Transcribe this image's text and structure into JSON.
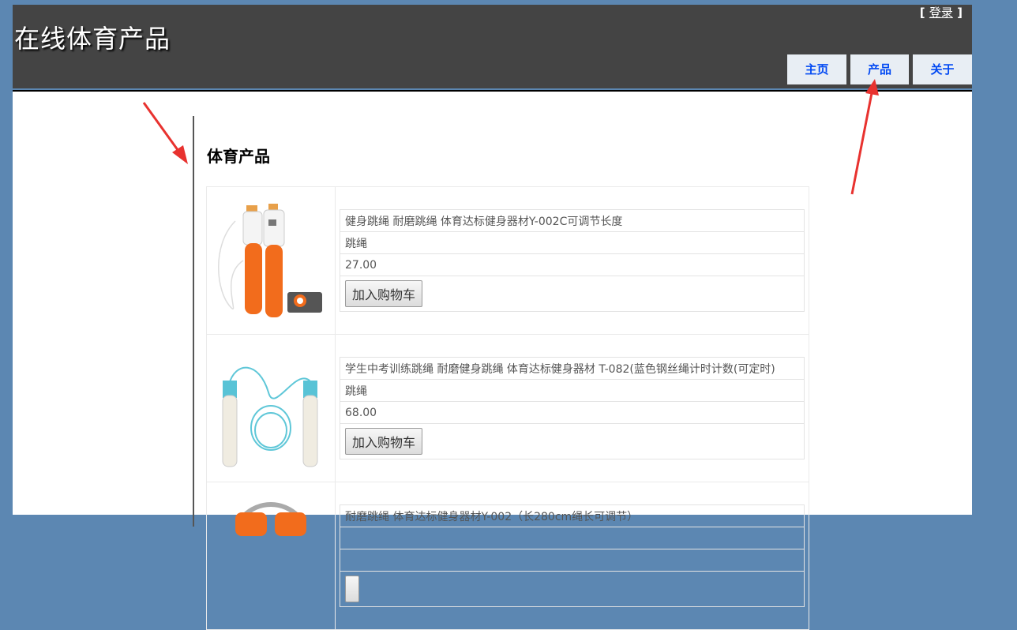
{
  "header": {
    "site_title": "在线体育产品",
    "login_bracket_open": "[",
    "login_label": "登录",
    "login_bracket_close": "]"
  },
  "menu": [
    {
      "label": "主页"
    },
    {
      "label": "产品"
    },
    {
      "label": "关于"
    }
  ],
  "main": {
    "section_title": "体育产品",
    "products": [
      {
        "name": "健身跳绳 耐磨跳绳 体育达标健身器材Y-002C可调节长度",
        "category": "跳绳",
        "price": "27.00",
        "button": "加入购物车"
      },
      {
        "name": "学生中考训练跳绳 耐磨健身跳绳 体育达标健身器材 T-082(蓝色钢丝绳计时计数(可定时)",
        "category": "跳绳",
        "price": "68.00",
        "button": "加入购物车"
      },
      {
        "name": "耐磨跳绳 体育达标健身器材Y-002（长280cm绳长可调节）",
        "category": "",
        "price": "",
        "button": ""
      }
    ]
  },
  "colors": {
    "background": "#5c87b2",
    "header": "#444444",
    "menu_bg": "#e8eef4",
    "menu_text": "#034af3",
    "annotation_arrow": "#e8322f"
  },
  "icons": {
    "product_1": "orange-jump-rope-image",
    "product_2": "blue-jump-rope-image",
    "product_3": "orange-jump-rope-image"
  }
}
